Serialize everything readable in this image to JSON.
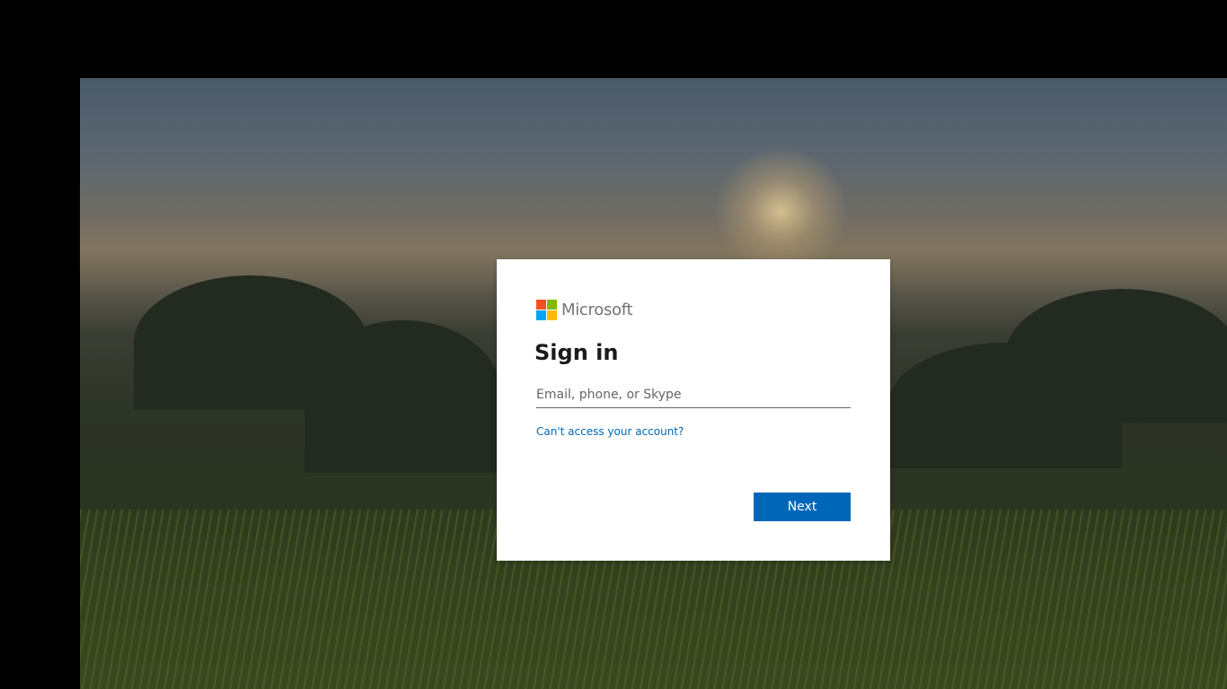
{
  "brand": {
    "name": "Microsoft",
    "logo_colors": [
      "#f25022",
      "#7fba00",
      "#00a4ef",
      "#ffb900"
    ]
  },
  "signin": {
    "title": "Sign in",
    "email_placeholder": "Email, phone, or Skype",
    "email_value": "",
    "cant_access_link": "Can't access your account?",
    "next_label": "Next"
  },
  "colors": {
    "accent": "#0067b8",
    "page_background": "#000000"
  }
}
